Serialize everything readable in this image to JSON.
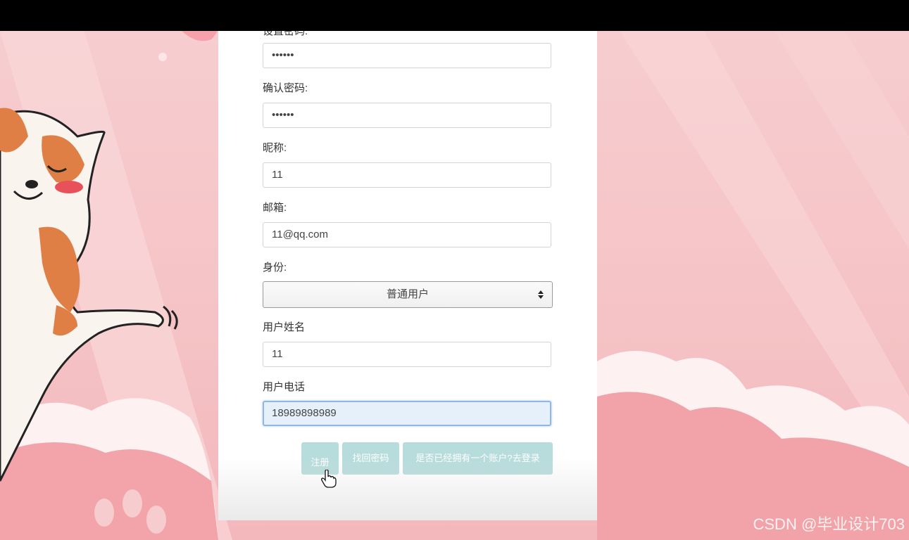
{
  "form": {
    "password": {
      "label": "设置密码:",
      "value": "••••••"
    },
    "confirm_password": {
      "label": "确认密码:",
      "value": "••••••"
    },
    "nickname": {
      "label": "昵称:",
      "value": "11"
    },
    "email": {
      "label": "邮箱:",
      "value": "11@qq.com"
    },
    "role": {
      "label": "身份:",
      "selected": "普通用户"
    },
    "real_name": {
      "label": "用户姓名",
      "value": "11"
    },
    "phone": {
      "label": "用户电话",
      "value": "18989898989"
    }
  },
  "buttons": {
    "register": "注册",
    "recover_password": "找回密码",
    "go_login": "是否已经拥有一个账户?去登录"
  },
  "watermark": "CSDN @毕业设计703",
  "colors": {
    "background_pink": "#f6c6c8",
    "button_teal": "#b7dcdc",
    "focus_blue": "#8fb8e3"
  }
}
